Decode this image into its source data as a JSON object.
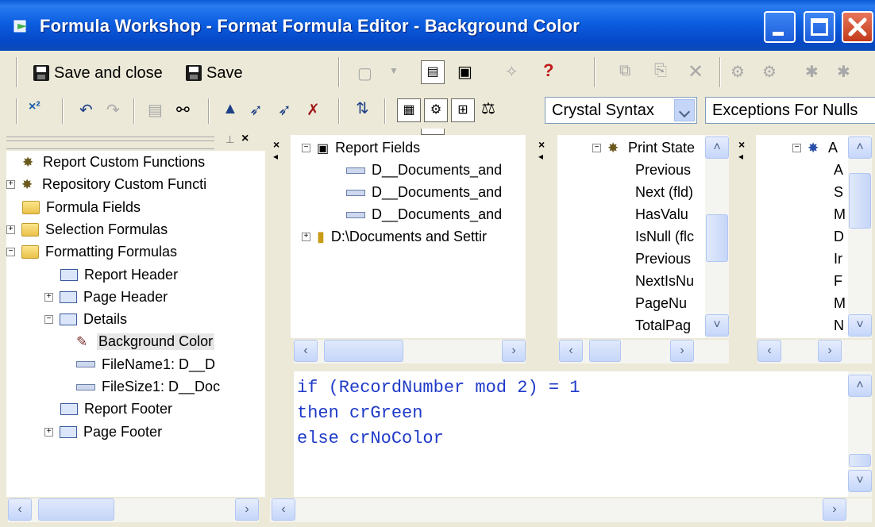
{
  "window": {
    "title": "Formula Workshop - Format Formula Editor - Background Color",
    "colors": {
      "title_bar": "#0c5ee0",
      "code_text": "#1f3ac8"
    }
  },
  "toolbar1": {
    "save_close_label": "Save and close",
    "save_label": "Save",
    "help_icon_glyph": "?"
  },
  "toolbar2": {
    "syntax_value": "Crystal Syntax",
    "nulls_value": "Exceptions For Nulls"
  },
  "tree": {
    "items": [
      {
        "label": "Report Custom Functions",
        "icon": "gear-icon"
      },
      {
        "label": "Repository Custom Functi",
        "icon": "gear-icon",
        "expand": "+"
      },
      {
        "label": "Formula Fields",
        "icon": "folder-icon"
      },
      {
        "label": "Selection Formulas",
        "icon": "folder-icon",
        "expand": "+"
      },
      {
        "label": "Formatting Formulas",
        "icon": "folder-icon",
        "expand": "−"
      },
      {
        "label": "Report Header",
        "icon": "section-icon"
      },
      {
        "label": "Page Header",
        "icon": "section-icon",
        "expand": "+"
      },
      {
        "label": "Details",
        "icon": "section-icon",
        "expand": "−"
      },
      {
        "label": "Background Color",
        "icon": "formula-icon"
      },
      {
        "label": "FileName1: D__D",
        "icon": "field-icon"
      },
      {
        "label": "FileSize1: D__Doc",
        "icon": "field-icon"
      },
      {
        "label": "Report Footer",
        "icon": "section-icon"
      },
      {
        "label": "Page Footer",
        "icon": "section-icon",
        "expand": "+"
      }
    ]
  },
  "fields_pane": {
    "root": "Report Fields",
    "children": [
      "D__Documents_and",
      "D__Documents_and",
      "D__Documents_and"
    ],
    "database": "D:\\Documents and Settir"
  },
  "functions_pane": {
    "root": "Print State",
    "items": [
      "Previous",
      "Next (fld)",
      "HasValu",
      "IsNull (flc",
      "Previous",
      "NextIsNu",
      "PageNu",
      "TotalPag"
    ]
  },
  "operators_pane": {
    "root": "A",
    "items": [
      "A",
      "S",
      "M",
      "D",
      "Ir",
      "F",
      "M",
      "N"
    ]
  },
  "editor": {
    "lines": [
      "if (RecordNumber mod 2) = 1",
      "then crGreen",
      "else crNoColor"
    ]
  }
}
